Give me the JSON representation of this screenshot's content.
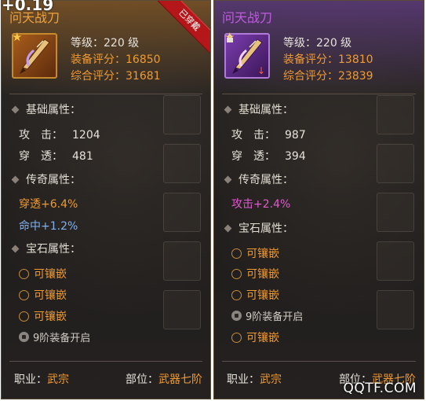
{
  "overlay_text": "+0.19",
  "watermark": "QQTF.COM",
  "left": {
    "name": "问天战刀",
    "ribbon": "已穿戴",
    "level": "等级：220 级",
    "equip_score": "装备评分：16850",
    "total_score": "综合评分：31681",
    "base_title": "基础属性：",
    "base_attrs": [
      {
        "label": "攻　击：",
        "value": "1204"
      },
      {
        "label": "穿　透：",
        "value": "481"
      }
    ],
    "legend_title": "传奇属性：",
    "legend_attrs": [
      "穿透+6.4%",
      "命中+1.2%"
    ],
    "gem_title": "宝石属性：",
    "gem_slots": [
      "可镶嵌",
      "可镶嵌",
      "可镶嵌"
    ],
    "gem_locked": "9阶装备开启",
    "job_label": "职业：",
    "job_value": "武宗",
    "part_label": "部位：",
    "part_value": "武器七阶",
    "colors": {
      "name": "#f0a23a",
      "accent": "#f09a32",
      "legend_blue": "#7fb2f0"
    }
  },
  "right": {
    "name": "问天战刀",
    "level": "等级：220 级",
    "equip_score": "装备评分：13810",
    "total_score": "综合评分：23839",
    "base_title": "基础属性：",
    "base_attrs": [
      {
        "label": "攻　击：",
        "value": "987"
      },
      {
        "label": "穿　透：",
        "value": "394"
      }
    ],
    "legend_title": "传奇属性：",
    "legend_attrs": [
      "攻击+2.4%"
    ],
    "gem_title": "宝石属性：",
    "gem_slots": [
      "可镶嵌",
      "可镶嵌",
      "可镶嵌"
    ],
    "gem_locked": "9阶装备开启",
    "gem_slot_last": "可镶嵌",
    "job_label": "职业：",
    "job_value": "武宗",
    "part_label": "部位：",
    "part_value": "武器七阶",
    "colors": {
      "name": "#c05be0",
      "accent": "#f09a32",
      "legend_pink": "#e25ad2"
    }
  },
  "icons": [
    "star-icon",
    "lock-icon",
    "down-arrow-icon",
    "gem-circle-icon",
    "diamond-icon",
    "sword-icon"
  ]
}
